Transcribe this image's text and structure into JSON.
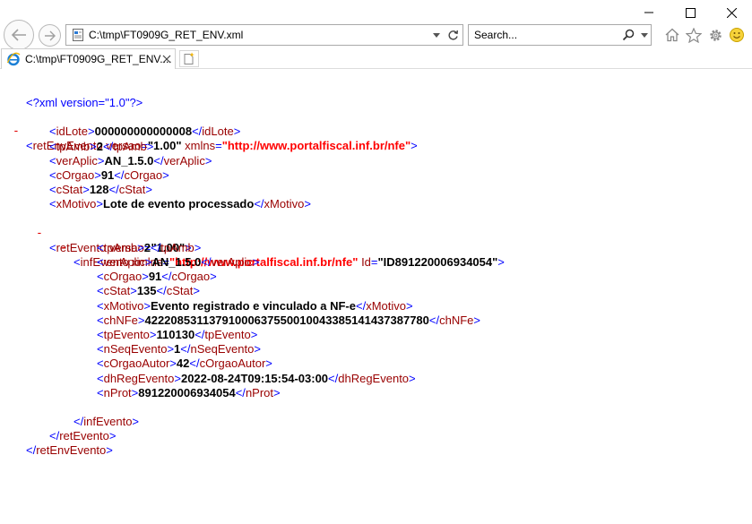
{
  "window": {
    "controls": [
      "minimize",
      "maximize",
      "close"
    ]
  },
  "navigation": {
    "address_value": "C:\\tmp\\FT0909G_RET_ENV.xml",
    "search_placeholder": "Search...",
    "tools": [
      "home-icon",
      "star-icon",
      "gear-icon",
      "smiley-icon"
    ]
  },
  "tab": {
    "title": "C:\\tmp\\FT0909G_RET_ENV...."
  },
  "xml": {
    "pi": "<?xml version=\"1.0\"?>",
    "root": {
      "name": "retEnvEvento",
      "attr1_name": "versao",
      "attr1_value": "\"1.00\"",
      "attr2_name": "xmlns",
      "attr2_value": "\"http://www.portalfiscal.inf.br/nfe\""
    },
    "header_fields": [
      {
        "tag": "idLote",
        "value": "000000000000008"
      },
      {
        "tag": "tpAmb",
        "value": "2"
      },
      {
        "tag": "verAplic",
        "value": "AN_1.5.0"
      },
      {
        "tag": "cOrgao",
        "value": "91"
      },
      {
        "tag": "cStat",
        "value": "128"
      },
      {
        "tag": "xMotivo",
        "value": "Lote de evento processado"
      }
    ],
    "retEvento": {
      "name": "retEvento",
      "attr_name": "versao",
      "attr_value": "\"1.00\""
    },
    "infEvento": {
      "name": "infEvento",
      "attr1_name": "xmlns",
      "attr1_value": "\"http://www.portalfiscal.inf.br/nfe\"",
      "attr2_name": "Id",
      "attr2_value": "\"ID891220006934054\""
    },
    "event_fields": [
      {
        "tag": "tpAmb",
        "value": "2"
      },
      {
        "tag": "verAplic",
        "value": "AN_1.5.0"
      },
      {
        "tag": "cOrgao",
        "value": "91"
      },
      {
        "tag": "cStat",
        "value": "135"
      },
      {
        "tag": "xMotivo",
        "value": "Evento registrado e vinculado a NF-e"
      },
      {
        "tag": "chNFe",
        "value": "42220853113791000637550010043385141437387780"
      },
      {
        "tag": "tpEvento",
        "value": "110130"
      },
      {
        "tag": "nSeqEvento",
        "value": "1"
      },
      {
        "tag": "cOrgaoAutor",
        "value": "42"
      },
      {
        "tag": "dhRegEvento",
        "value": "2022-08-24T09:15:54-03:00"
      },
      {
        "tag": "nProt",
        "value": "891220006934054"
      }
    ],
    "collapse_marker": "-"
  }
}
